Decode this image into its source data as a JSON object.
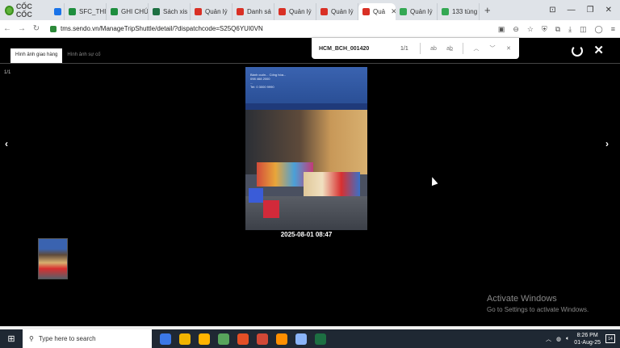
{
  "browser": {
    "brand": "CỐC CỐC",
    "tabs": [
      {
        "label": "",
        "color": "#1a73e8"
      },
      {
        "label": "SFC_THI",
        "color": "#1e8e3e"
      },
      {
        "label": "GHI CHÚ",
        "color": "#1e8e3e"
      },
      {
        "label": "Sách xis",
        "color": "#1d6f42"
      },
      {
        "label": "Quản lý",
        "color": "#d93025"
      },
      {
        "label": "Danh sá",
        "color": "#d93025"
      },
      {
        "label": "Quản lý",
        "color": "#d93025"
      },
      {
        "label": "Quản lý",
        "color": "#d93025"
      },
      {
        "label": "Quả",
        "color": "#d93025",
        "active": true
      },
      {
        "label": "Quản lý",
        "color": "#34a853"
      },
      {
        "label": "133 tùng",
        "color": "#34a853"
      }
    ],
    "url": "tms.sendo.vn/ManageTripShuttle/detail/?dispatchcode=S25Q6YUI0VN"
  },
  "viewer": {
    "tab_delivery": "Hình ảnh giao hàng",
    "tab_incident": "Hình ảnh sự cố",
    "counter": "1/1",
    "timestamp": "2025-08-01 08:47",
    "photo_overlay": "Bánh cuốn... Cống hòa...\n098 468 2000\n...\nTel: 0 3000 9990"
  },
  "find": {
    "query": "HCM_BCH_001420",
    "count": "1/1",
    "match_case": "ab",
    "whole_word": "ab̲"
  },
  "watermark": {
    "title": "Activate Windows",
    "subtitle": "Go to Settings to activate Windows."
  },
  "taskbar": {
    "search_placeholder": "Type here to search",
    "time": "8:26 PM",
    "date": "01-Aug-25",
    "notifications": "14",
    "apps": [
      "#3b78e7",
      "#f0b400",
      "#ffb400",
      "#58a55c",
      "#e34f26",
      "#d14836",
      "#ff8f00",
      "#8ab4f8",
      "#1d6f42"
    ]
  }
}
